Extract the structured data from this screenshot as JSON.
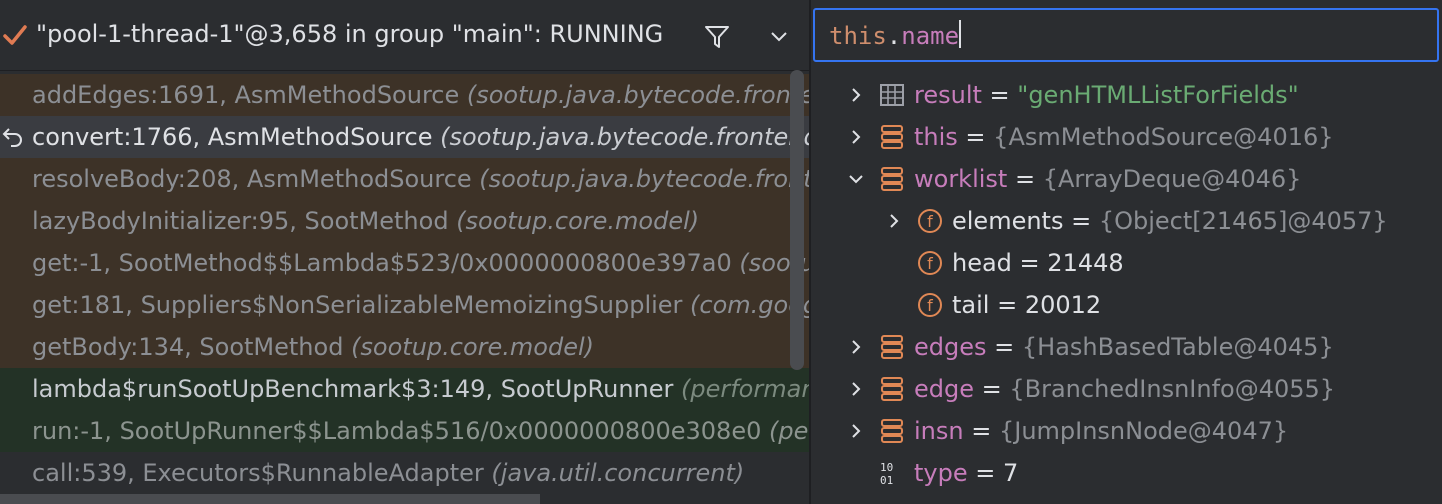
{
  "thread": {
    "label": "\"pool-1-thread-1\"@3,658 in group \"main\": RUNNING",
    "status_icon": "check-icon",
    "filter_icon": "filter-icon",
    "dropdown_icon": "chevron-down-icon"
  },
  "frames": [
    {
      "method": "addEdges:1691, AsmMethodSource ",
      "pkg": "(sootup.java.bytecode.frontend.conversion)",
      "kind": "lib"
    },
    {
      "method": "convert:1766, AsmMethodSource ",
      "pkg": "(sootup.java.bytecode.frontend.conversion)",
      "kind": "cur"
    },
    {
      "method": "resolveBody:208, AsmMethodSource ",
      "pkg": "(sootup.java.bytecode.frontend.conversion)",
      "kind": "lib"
    },
    {
      "method": "lazyBodyInitializer:95, SootMethod ",
      "pkg": "(sootup.core.model)",
      "kind": "lib"
    },
    {
      "method": "get:-1, SootMethod$$Lambda$523/0x0000000800e397a0 ",
      "pkg": "(sootup.core.model)",
      "kind": "lib"
    },
    {
      "method": "get:181, Suppliers$NonSerializableMemoizingSupplier ",
      "pkg": "(com.google.common.base)",
      "kind": "lib"
    },
    {
      "method": "getBody:134, SootMethod ",
      "pkg": "(sootup.core.model)",
      "kind": "lib"
    },
    {
      "method": "lambda$runSootUpBenchmark$3:149, SootUpRunner ",
      "pkg": "(performance)",
      "kind": "usr"
    },
    {
      "method": "run:-1, SootUpRunner$$Lambda$516/0x0000000800e308e0 ",
      "pkg": "(performance)",
      "kind": "usr2"
    },
    {
      "method": "call:539, Executors$RunnableAdapter ",
      "pkg": "(java.util.concurrent)",
      "kind": "plain"
    }
  ],
  "expression": {
    "keyword": "this",
    "dot": ".",
    "field": "name"
  },
  "variables": [
    {
      "expander": "collapsed",
      "icon": "result-table-icon",
      "name": "result",
      "value": "\"genHTMLListForFields\"",
      "vtype": "string",
      "indent": 0
    },
    {
      "expander": "collapsed",
      "icon": "object-icon",
      "name": "this",
      "value": "{AsmMethodSource@4016}",
      "vtype": "ref",
      "indent": 0
    },
    {
      "expander": "expanded",
      "icon": "object-icon",
      "name": "worklist",
      "value": "{ArrayDeque@4046}",
      "vtype": "ref",
      "indent": 0
    },
    {
      "expander": "collapsed",
      "icon": "field-icon",
      "name": "elements",
      "value": "{Object[21465]@4057}",
      "vtype": "ref",
      "indent": 1
    },
    {
      "expander": "none",
      "icon": "field-icon",
      "name": "head",
      "value": "21448",
      "vtype": "num",
      "indent": 1
    },
    {
      "expander": "none",
      "icon": "field-icon",
      "name": "tail",
      "value": "20012",
      "vtype": "num",
      "indent": 1
    },
    {
      "expander": "collapsed",
      "icon": "object-icon",
      "name": "edges",
      "value": "{HashBasedTable@4045}",
      "vtype": "ref",
      "indent": 0
    },
    {
      "expander": "collapsed",
      "icon": "object-icon",
      "name": "edge",
      "value": "{BranchedInsnInfo@4055}",
      "vtype": "ref",
      "indent": 0
    },
    {
      "expander": "collapsed",
      "icon": "object-icon",
      "name": "insn",
      "value": "{JumpInsnNode@4047}",
      "vtype": "ref",
      "indent": 0
    },
    {
      "expander": "none",
      "icon": "primitive-icon",
      "name": "type",
      "value": "7",
      "vtype": "num",
      "indent": 0
    }
  ],
  "colors": {
    "accent": "#3574f0",
    "string": "#6aab73",
    "field": "#c77dbb",
    "keyword": "#cf8e6d",
    "icon_orange": "#e08855"
  }
}
